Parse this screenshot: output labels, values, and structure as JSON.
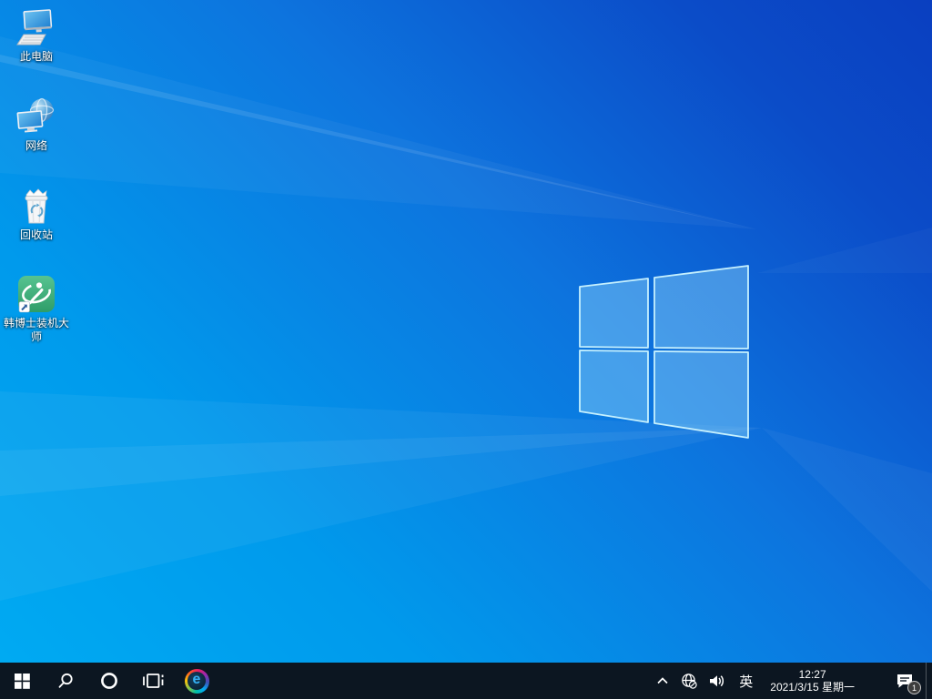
{
  "desktop": {
    "icons": [
      {
        "label": "此电脑",
        "icon": "this-pc-icon"
      },
      {
        "label": "网络",
        "icon": "network-icon"
      },
      {
        "label": "回收站",
        "icon": "recycle-bin-icon"
      },
      {
        "label": "韩博士装机大师",
        "icon": "hanboshi-app-icon"
      }
    ]
  },
  "taskbar": {
    "start": {
      "icon": "windows-start-icon"
    },
    "search": {
      "icon": "search-icon"
    },
    "cortana": {
      "icon": "cortana-circle-icon"
    },
    "task_view": {
      "icon": "task-view-icon"
    },
    "browser": {
      "icon": "browser-rainbow-ring-icon",
      "letter": "e"
    },
    "tray": {
      "hidden_icons": {
        "icon": "chevron-up-icon"
      },
      "network": {
        "icon": "globe-no-internet-icon"
      },
      "volume": {
        "icon": "speaker-icon"
      },
      "input_indicator": "英",
      "clock": {
        "time": "12:27",
        "date": "2021/3/15 星期一"
      },
      "action_center": {
        "icon": "action-center-icon",
        "notification_count": "1"
      },
      "show_desktop": {
        "icon": "show-desktop-strip"
      }
    }
  },
  "wallpaper": {
    "description": "windows-10-light-ray-logo",
    "colors": {
      "bottom_left": "#00aaf2",
      "top_right": "#0a3fc0",
      "logo_pane_fill": "#4cb4f0",
      "logo_edge": "#b9f0ff"
    }
  },
  "colors": {
    "taskbar_background": "#0c1621",
    "hanboshi_green": "#3fae77",
    "browser_letter_blue": "#35b1f5",
    "icon_label_text": "#ffffff"
  }
}
